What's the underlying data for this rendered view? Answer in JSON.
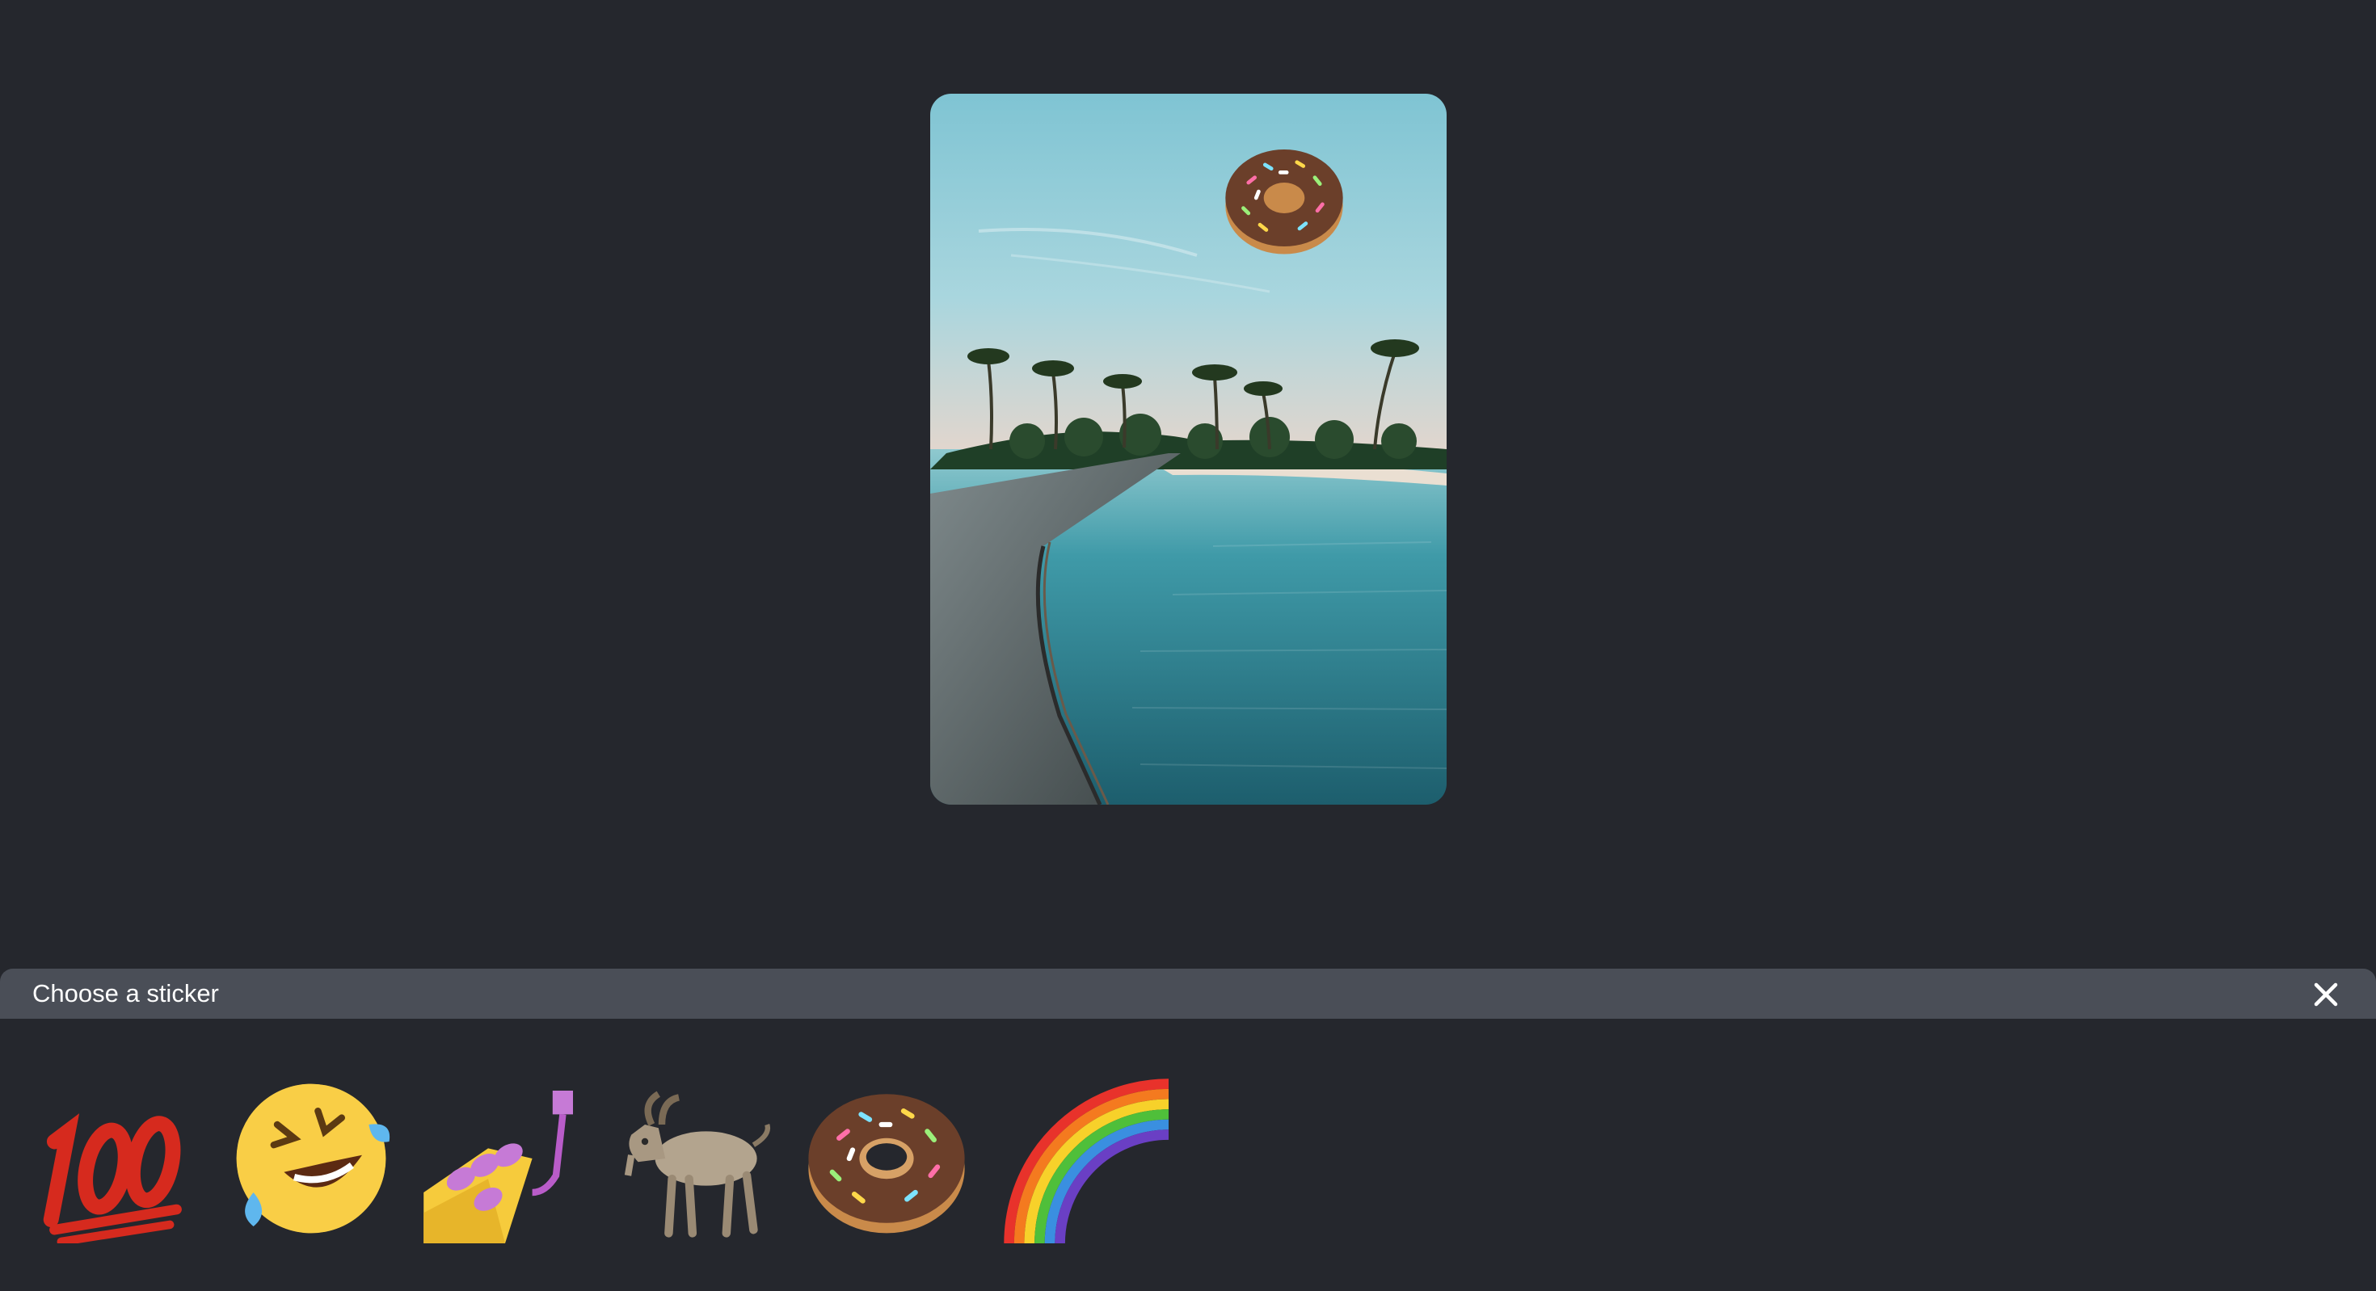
{
  "editor": {
    "photo": {
      "subject": "beach-boardwalk-photo",
      "placed_sticker": "donut-icon"
    }
  },
  "sticker_panel": {
    "title": "Choose a sticker",
    "close_icon": "close-icon",
    "stickers": [
      {
        "name": "hundred-points-icon"
      },
      {
        "name": "rolling-laughing-icon"
      },
      {
        "name": "nail-polish-icon"
      },
      {
        "name": "goat-icon"
      },
      {
        "name": "donut-icon"
      },
      {
        "name": "rainbow-icon"
      }
    ]
  },
  "colors": {
    "background": "#25272d",
    "header": "#4a4e57",
    "text": "#ffffff"
  }
}
